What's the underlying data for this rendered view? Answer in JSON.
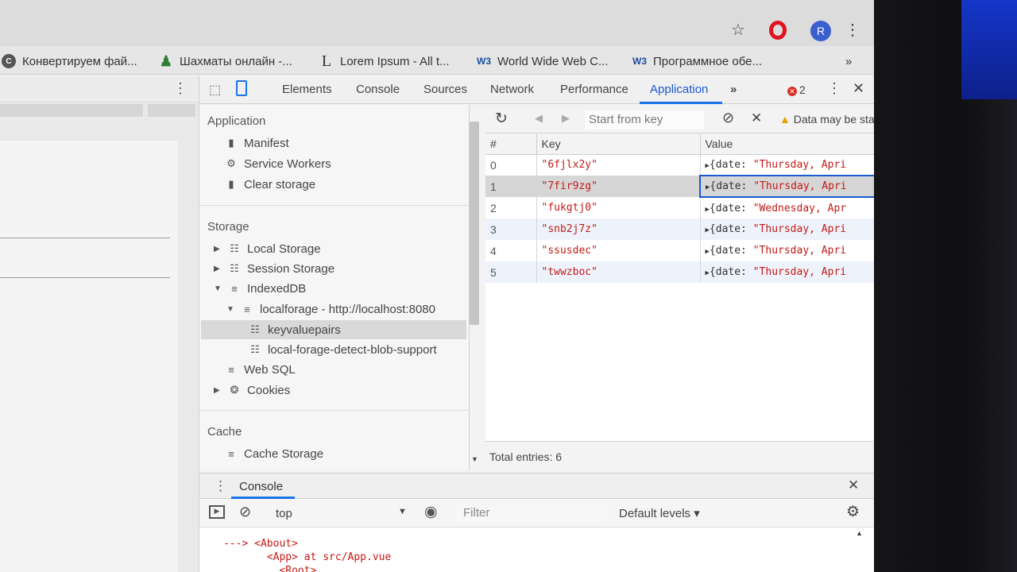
{
  "browser": {
    "avatar_letter": "R",
    "bookmarks": [
      {
        "label": "Конвертируем фай...",
        "icon": "C"
      },
      {
        "label": "Шахматы онлайн -...",
        "icon": "♟"
      },
      {
        "label": "Lorem Ipsum - All t...",
        "icon": "L"
      },
      {
        "label": "World Wide Web C...",
        "icon": "W3"
      },
      {
        "label": "Программное обе...",
        "icon": "W3"
      }
    ],
    "more": "»"
  },
  "devtools": {
    "tabs": [
      "Elements",
      "Console",
      "Sources",
      "Network",
      "Performance",
      "Application"
    ],
    "active_tab": "Application",
    "more_tabs": "»",
    "error_count": "2"
  },
  "sidebar": {
    "application_header": "Application",
    "application_items": [
      "Manifest",
      "Service Workers",
      "Clear storage"
    ],
    "storage_header": "Storage",
    "storage_items": {
      "local_storage": "Local Storage",
      "session_storage": "Session Storage",
      "indexeddb": "IndexedDB",
      "db": "localforage - http://localhost:8080",
      "store1": "keyvaluepairs",
      "store2": "local-forage-detect-blob-support",
      "websql": "Web SQL",
      "cookies": "Cookies"
    },
    "cache_header": "Cache",
    "cache_items": [
      "Cache Storage"
    ]
  },
  "data_view": {
    "key_placeholder": "Start from key",
    "warning": "Data may be stale",
    "columns": [
      "#",
      "Key",
      "Value"
    ],
    "rows": [
      {
        "index": "0",
        "key": "\"6fjlx2y\"",
        "value_prefix": "{date: ",
        "value_str": "\"Thursday, Apri"
      },
      {
        "index": "1",
        "key": "\"7fir9zg\"",
        "value_prefix": "{date: ",
        "value_str": "\"Thursday, Apri"
      },
      {
        "index": "2",
        "key": "\"fukgtj0\"",
        "value_prefix": "{date: ",
        "value_str": "\"Wednesday, Apr"
      },
      {
        "index": "3",
        "key": "\"snb2j7z\"",
        "value_prefix": "{date: ",
        "value_str": "\"Thursday, Apri"
      },
      {
        "index": "4",
        "key": "\"ssusdec\"",
        "value_prefix": "{date: ",
        "value_str": "\"Thursday, Apri"
      },
      {
        "index": "5",
        "key": "\"twwzboc\"",
        "value_prefix": "{date: ",
        "value_str": "\"Thursday, Apri"
      }
    ],
    "selected_row": 1,
    "total": "Total entries: 6"
  },
  "console": {
    "tab": "Console",
    "context": "top",
    "filter_placeholder": "Filter",
    "levels": "Default levels ▾",
    "lines": [
      "---> <About>",
      "       <App> at src/App.vue",
      "         <Root>"
    ]
  },
  "colors": {
    "accent": "#1a73e8",
    "string_red": "#c41a16",
    "error_red": "#d93025"
  }
}
